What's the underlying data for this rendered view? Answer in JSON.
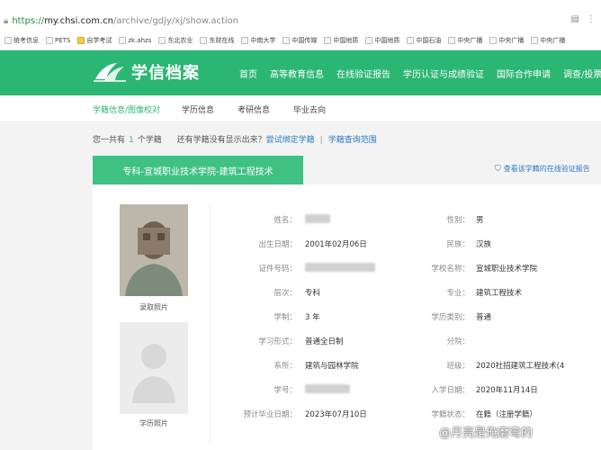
{
  "browser": {
    "url_proto": "https://",
    "url_rest_host": "my.chsi.com.cn",
    "url_rest_path": "/archive/gdjy/xj/show.action",
    "bookmarks": [
      "统考信息",
      "PETS",
      "自学考试",
      "zk.ahzs",
      "东北农业",
      "东财在线",
      "中南大学",
      "中国传媒",
      "中国地质",
      "中国地质",
      "中国石油",
      "中央广播",
      "中央广播",
      "中央广播"
    ]
  },
  "header": {
    "logo_text": "学信档案",
    "nav": [
      "首页",
      "高等教育信息",
      "在线验证报告",
      "学历认证与成绩验证",
      "国际合作申请",
      "调查/投票"
    ]
  },
  "subnav": {
    "tabs": [
      "学籍信息/图像校对",
      "学历信息",
      "考研信息",
      "毕业去向"
    ]
  },
  "summary": {
    "prefix": "您一共有",
    "count": "1",
    "suffix": "个学籍",
    "question": "还有学籍没有显示出来？",
    "bind_link": "尝试绑定学籍",
    "sep": "|",
    "scope_link": "学籍查询范围"
  },
  "record": {
    "tab_title": "专科-宣城职业技术学院-建筑工程技术",
    "verify_link": "查看该学籍的在线验证报告",
    "photo1_caption": "录取照片",
    "photo2_caption": "学历照片",
    "fields_left": [
      {
        "label": "姓名：",
        "value": ""
      },
      {
        "label": "出生日期：",
        "value": "2001年02月06日"
      },
      {
        "label": "证件号码：",
        "value": ""
      },
      {
        "label": "层次：",
        "value": "专科"
      },
      {
        "label": "学制：",
        "value": "3 年"
      },
      {
        "label": "学习形式：",
        "value": "普通全日制"
      },
      {
        "label": "系所：",
        "value": "建筑与园林学院"
      },
      {
        "label": "学号：",
        "value": ""
      },
      {
        "label": "预计毕业日期：",
        "value": "2023年07月10日"
      }
    ],
    "fields_right": [
      {
        "label": "性别：",
        "value": "男"
      },
      {
        "label": "民族：",
        "value": "汉族"
      },
      {
        "label": "学校名称：",
        "value": "宣城职业技术学院"
      },
      {
        "label": "专业：",
        "value": "建筑工程技术"
      },
      {
        "label": "学历类别：",
        "value": "普通"
      },
      {
        "label": "分院：",
        "value": ""
      },
      {
        "label": "班级：",
        "value": "2020社招建筑工程技术(4"
      },
      {
        "label": "入学日期：",
        "value": "2020年11月14日"
      },
      {
        "label": "学籍状态：",
        "value": "在籍（注册学籍）"
      }
    ]
  },
  "watermark": "@月亮是俺磨弯的",
  "colors": {
    "brand_green": "#2bb673",
    "link_blue": "#2b7cc1"
  }
}
